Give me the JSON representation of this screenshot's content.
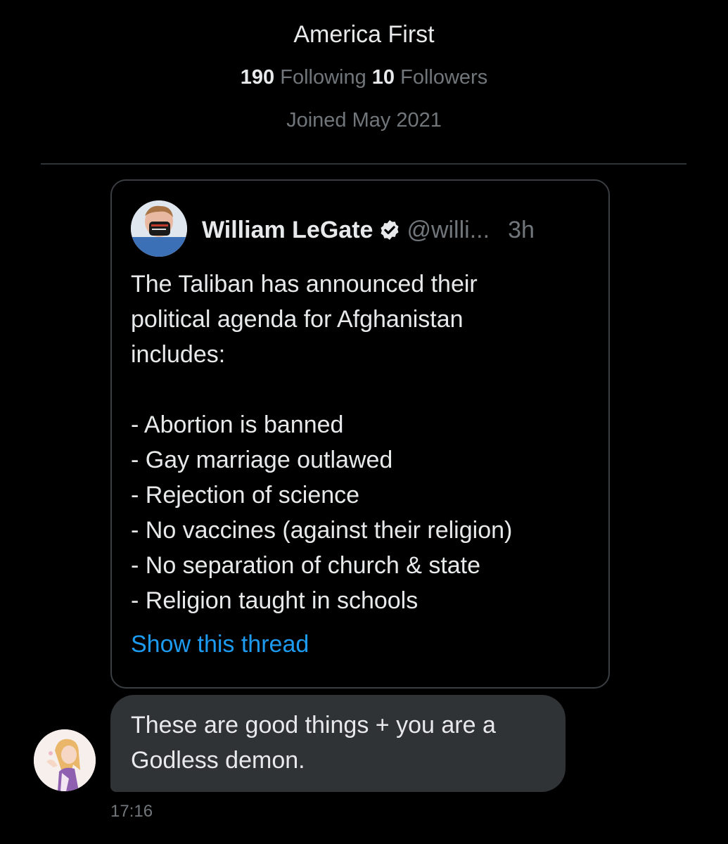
{
  "profile": {
    "name": "America First",
    "following_count": "190",
    "following_label": "Following",
    "followers_count": "10",
    "followers_label": "Followers",
    "joined": "Joined May 2021"
  },
  "quoted_tweet": {
    "author_name": "William LeGate",
    "verified_icon": "verified-badge-icon",
    "handle": "@willi...",
    "time": "3h",
    "body_lines": [
      "The Taliban has announced their",
      "political agenda for Afghanistan",
      "includes:",
      "",
      "- Abortion is banned",
      "- Gay marriage outlawed",
      "- Rejection of science",
      "- No vaccines (against their religion)",
      "- No separation of church & state",
      "- Religion taught in schools"
    ],
    "show_thread": "Show this thread"
  },
  "reply": {
    "lines": [
      "These are good things + you are a",
      "Godless demon."
    ],
    "time": "17:16"
  },
  "colors": {
    "background": "#000000",
    "text": "#e7e9ea",
    "secondary_text": "#71767b",
    "link": "#1d9bf0",
    "bubble": "#2f3336"
  }
}
